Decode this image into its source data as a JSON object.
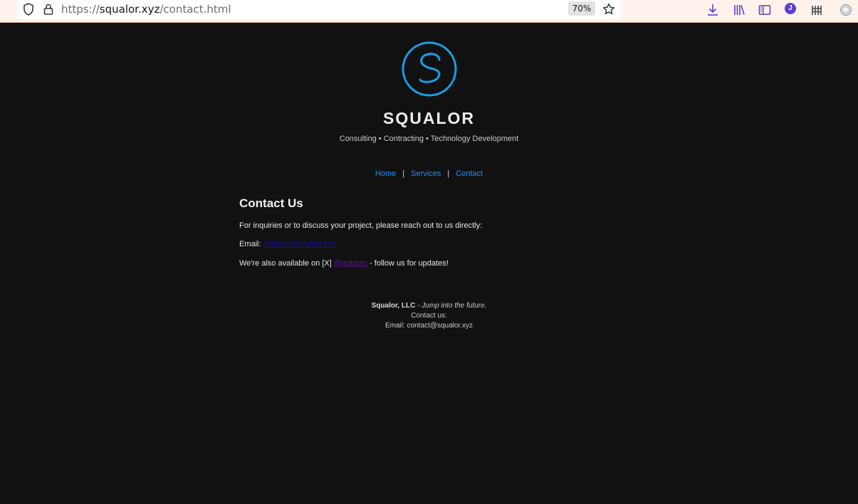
{
  "browser": {
    "url_scheme": "https://",
    "url_host": "squalor.xyz",
    "url_path": "/contact.html",
    "zoom": "70%",
    "profile_initial": "J",
    "icons": [
      "shield-icon",
      "lock-icon",
      "star-icon",
      "download-icon",
      "library-icon",
      "sidebar-icon",
      "account-icon",
      "extensions-icon",
      "firefox-view-icon"
    ]
  },
  "site": {
    "name": "SQUALOR",
    "tagline": "Consulting • Contracting • Technology Development",
    "logo_color": "#1a9ee6"
  },
  "nav": {
    "home": "Home",
    "services": "Services",
    "contact": "Contact",
    "separator": "|"
  },
  "contact": {
    "heading": "Contact Us",
    "intro": "For inquiries or to discuss your project, please reach out to us directly:",
    "email_label": "Email:",
    "email_link": "contact@squalor.xyz",
    "social_prefix": "We're also available on [X]",
    "social_handle": "@jrobbnc",
    "social_suffix": "- follow us for updates!"
  },
  "footer": {
    "company": "Squalor, LLC",
    "slogan": "- Jump into the future.",
    "contact_label": "Contact us:",
    "email_line": "Email: contact@squalor.xyz"
  }
}
